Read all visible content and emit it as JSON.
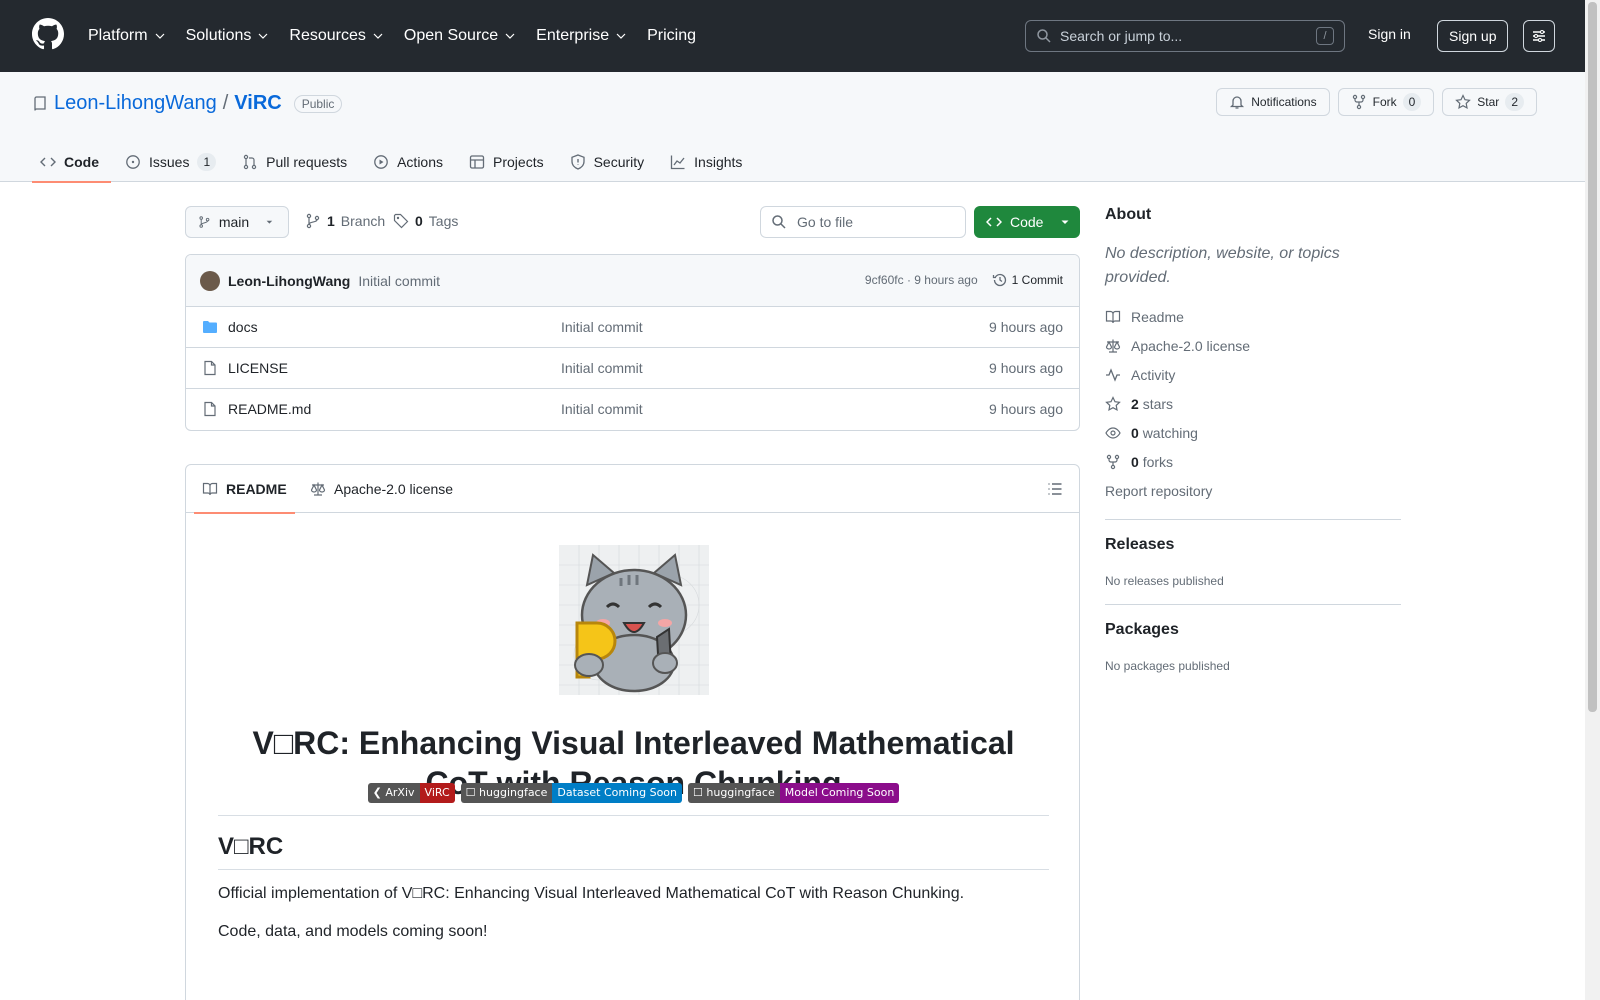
{
  "header": {
    "nav": [
      {
        "label": "Platform",
        "has_menu": true
      },
      {
        "label": "Solutions",
        "has_menu": true
      },
      {
        "label": "Resources",
        "has_menu": true
      },
      {
        "label": "Open Source",
        "has_menu": true
      },
      {
        "label": "Enterprise",
        "has_menu": true
      },
      {
        "label": "Pricing",
        "has_menu": false
      }
    ],
    "search_placeholder": "Search or jump to...",
    "search_shortcut": "/",
    "signin": "Sign in",
    "signup": "Sign up"
  },
  "repo": {
    "owner": "Leon-LihongWang",
    "separator": "/",
    "name": "ViRC",
    "visibility": "Public",
    "notifications": "Notifications",
    "fork_label": "Fork",
    "fork_count": "0",
    "star_label": "Star",
    "star_count": "2"
  },
  "tabs": [
    {
      "label": "Code",
      "count": null,
      "icon": "code-icon"
    },
    {
      "label": "Issues",
      "count": "1",
      "icon": "issue-icon"
    },
    {
      "label": "Pull requests",
      "count": null,
      "icon": "pull-request-icon"
    },
    {
      "label": "Actions",
      "count": null,
      "icon": "play-icon"
    },
    {
      "label": "Projects",
      "count": null,
      "icon": "table-icon"
    },
    {
      "label": "Security",
      "count": null,
      "icon": "shield-icon"
    },
    {
      "label": "Insights",
      "count": null,
      "icon": "graph-icon"
    }
  ],
  "toolbar": {
    "branch": "main",
    "branch_count": "1",
    "branch_label": "Branch",
    "tag_count": "0",
    "tag_label": "Tags",
    "goto_placeholder": "Go to file",
    "code_button": "Code"
  },
  "latest_commit": {
    "author": "Leon-LihongWang",
    "message": "Initial commit",
    "hash_time": "9cf60fc · 9 hours ago",
    "commit_count": "1 Commit"
  },
  "files": [
    {
      "name": "docs",
      "type": "folder",
      "message": "Initial commit",
      "time": "9 hours ago"
    },
    {
      "name": "LICENSE",
      "type": "file",
      "message": "Initial commit",
      "time": "9 hours ago"
    },
    {
      "name": "README.md",
      "type": "file",
      "message": "Initial commit",
      "time": "9 hours ago"
    }
  ],
  "readme": {
    "tab_readme": "README",
    "tab_license": "Apache-2.0 license",
    "title_line1": "V□RC: Enhancing Visual Interleaved Mathematical",
    "title_line2": "CoT with Reason Chunking",
    "badges": [
      {
        "left": "❮ ArXiv",
        "right": "ViRC",
        "color": "#b31b1b"
      },
      {
        "left": "☐ huggingface",
        "right": "Dataset Coming Soon",
        "color": "#007ec6"
      },
      {
        "left": "☐ huggingface",
        "right": "Model Coming Soon",
        "color": "#8b0d8b"
      }
    ],
    "h2": "V□RC",
    "p1": "Official implementation of V□RC: Enhancing Visual Interleaved Mathematical CoT with Reason Chunking.",
    "p2": "Code, data, and models coming soon!"
  },
  "sidebar": {
    "about_title": "About",
    "about_desc": "No description, website, or topics provided.",
    "items": [
      {
        "icon": "book-icon",
        "bold": "",
        "text": "Readme"
      },
      {
        "icon": "law-icon",
        "bold": "",
        "text": "Apache-2.0 license"
      },
      {
        "icon": "pulse-icon",
        "bold": "",
        "text": "Activity"
      },
      {
        "icon": "star-icon",
        "bold": "2",
        "text": "stars"
      },
      {
        "icon": "eye-icon",
        "bold": "0",
        "text": "watching"
      },
      {
        "icon": "fork-icon",
        "bold": "0",
        "text": "forks"
      }
    ],
    "report": "Report repository",
    "releases_title": "Releases",
    "releases_text": "No releases published",
    "packages_title": "Packages",
    "packages_text": "No packages published"
  },
  "colors": {
    "header_bg": "#24292f",
    "link": "#0969da",
    "code_button": "#1f883d",
    "active_tab_underline": "#fd8c73"
  }
}
